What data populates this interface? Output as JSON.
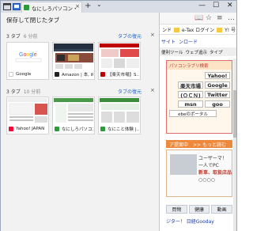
{
  "window": {
    "tab_title": "なにしろパソコン・ドットコム",
    "tab_close": "×",
    "new_tab": "+",
    "tab_menu": "⌄",
    "minimize": "—",
    "maximize": "☐",
    "close": "✕"
  },
  "panel": {
    "title": "保存して閉じたタブ",
    "groups": [
      {
        "count_label": "3 タブ",
        "time": "6 分前",
        "restore_label": "タブの復元",
        "close": "×",
        "cards": [
          {
            "caption": "Google",
            "icon_color": "#ffffff",
            "icon": "google-icon"
          },
          {
            "caption": "Amazon | 本, iPh...",
            "icon_color": "#222222",
            "icon": "amazon-icon"
          },
          {
            "caption": "【楽天市場】S...",
            "icon_color": "#bf0000",
            "icon": "rakuten-icon"
          }
        ]
      },
      {
        "count_label": "3 タブ",
        "time": "10 分前",
        "restore_label": "タブの復元",
        "close": "×",
        "cards": [
          {
            "caption": "Yahoo! JAPAN",
            "icon_color": "#ff0033",
            "icon": "yahoo-icon"
          },
          {
            "caption": "なにしろパソコン...",
            "icon_color": "#2e9b3b",
            "icon": "nanishiro-icon"
          },
          {
            "caption": "なにこと体験 |...",
            "icon_color": "#2e9b3b",
            "icon": "nanikoto-icon"
          }
        ]
      }
    ]
  },
  "page": {
    "favbar": [
      "e-Tax ログイン",
      "Y! 号"
    ],
    "favbar_first": "ンド",
    "nav": [
      "サイト",
      "ンロード"
    ],
    "nav2": [
      "便利ツール",
      "ウェブ追示",
      "タイプ"
    ],
    "hero_band": "パソコンラブリ検索",
    "quicklinks": [
      "Yahoo!",
      "楽天市場",
      "Google",
      "(ＯＣＮ)",
      "Twitter",
      "msn",
      "goo",
      "ebeのポータル"
    ],
    "promo_band": "ア提案中　>> もっと読む",
    "promo_text_1": "ユーザーマ！",
    "promo_text_2": "一人でPC",
    "promo_text_3": "新車、取扱店品",
    "promo_more": "○○○○",
    "bottom_tabs": [
      "買物",
      "健康",
      "動画"
    ],
    "footer": "ジター！ 日経Gooday"
  }
}
